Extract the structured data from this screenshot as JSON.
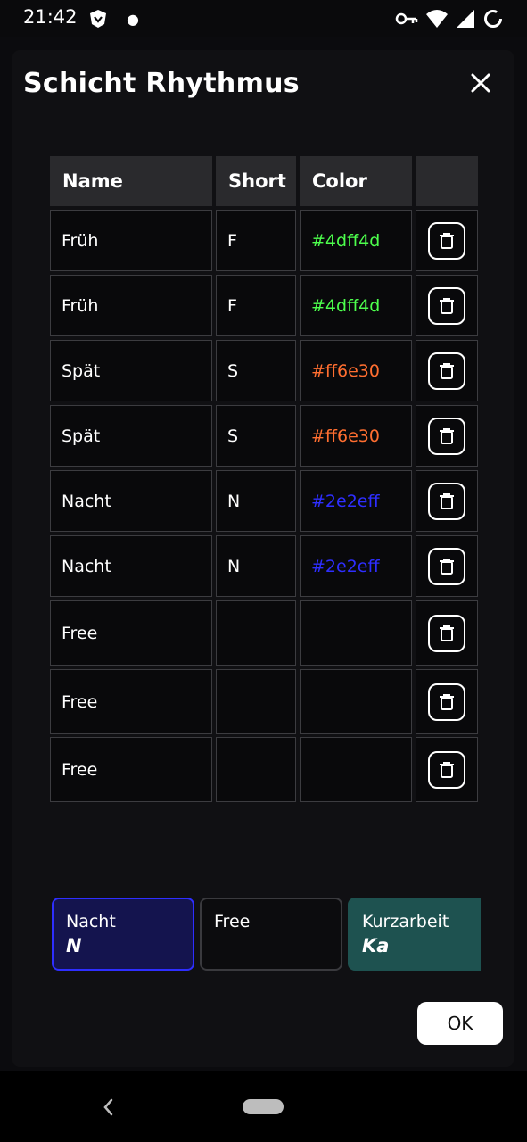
{
  "status": {
    "time": "21:42",
    "icons": [
      "app-shield-icon",
      "notification-dot",
      "vpn-key-icon",
      "wifi-icon",
      "signal-icon",
      "battery-icon"
    ]
  },
  "dialog": {
    "title": "Schicht Rhythmus",
    "columns": [
      "Name",
      "Short",
      "Color",
      ""
    ],
    "rows": [
      {
        "name": "Früh",
        "short": "F",
        "color": "#4dff4d"
      },
      {
        "name": "Früh",
        "short": "F",
        "color": "#4dff4d"
      },
      {
        "name": "Spät",
        "short": "S",
        "color": "#ff6e30"
      },
      {
        "name": "Spät",
        "short": "S",
        "color": "#ff6e30"
      },
      {
        "name": "Nacht",
        "short": "N",
        "color": "#2e2eff"
      },
      {
        "name": "Nacht",
        "short": "N",
        "color": "#2e2eff"
      },
      {
        "name": "Free",
        "short": "",
        "color": ""
      },
      {
        "name": "Free",
        "short": "",
        "color": ""
      },
      {
        "name": "Free",
        "short": "",
        "color": ""
      }
    ],
    "shift_chips": [
      {
        "name": "Nacht",
        "short": "N",
        "bg": "#14144e",
        "border": "#2e2eff"
      },
      {
        "name": "Free",
        "short": "",
        "bg": "#0c0c0e",
        "border": "#3a3a3e"
      },
      {
        "name": "Kurzarbeit",
        "short": "Ka",
        "bg": "#1e5250",
        "border": "#1e5250"
      }
    ],
    "ok_label": "OK"
  }
}
